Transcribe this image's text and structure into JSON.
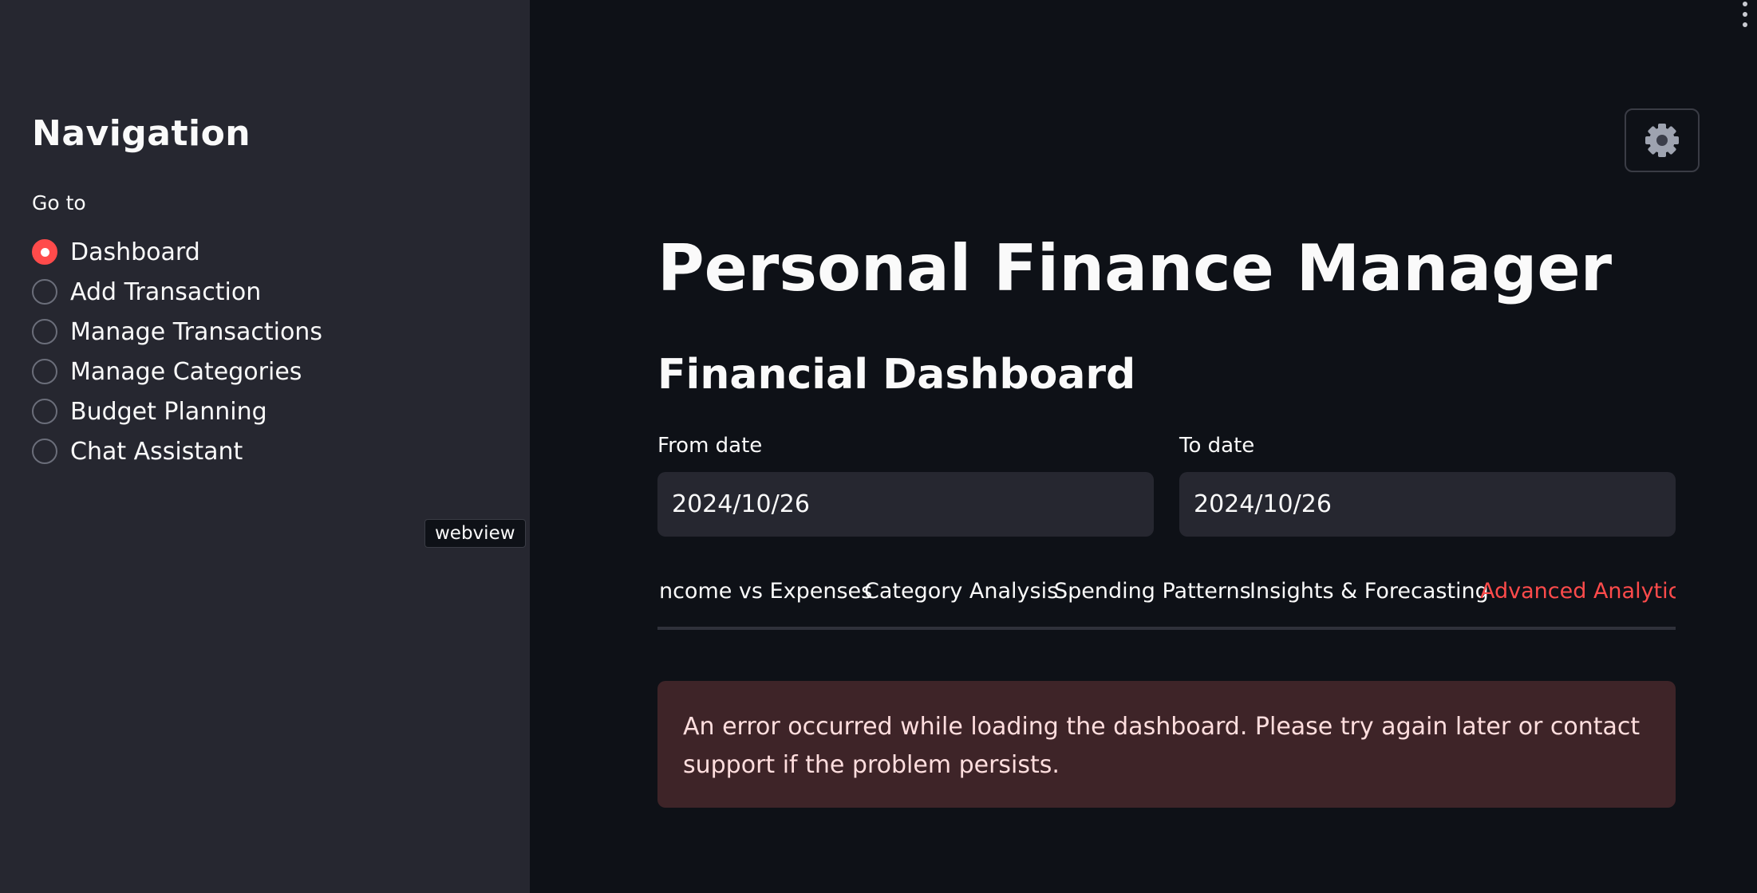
{
  "sidebar": {
    "title": "Navigation",
    "goto_label": "Go to",
    "items": [
      {
        "label": "Dashboard",
        "selected": true
      },
      {
        "label": "Add Transaction",
        "selected": false
      },
      {
        "label": "Manage Transactions",
        "selected": false
      },
      {
        "label": "Manage Categories",
        "selected": false
      },
      {
        "label": "Budget Planning",
        "selected": false
      },
      {
        "label": "Chat Assistant",
        "selected": false
      }
    ],
    "tooltip": "webview"
  },
  "header": {
    "settings_icon": "gear-icon",
    "menu_icon": "vertical-dots-icon"
  },
  "main": {
    "title": "Personal Finance Manager",
    "subtitle": "Financial Dashboard",
    "from_date": {
      "label": "From date",
      "value": "2024/10/26"
    },
    "to_date": {
      "label": "To date",
      "value": "2024/10/26"
    },
    "tabs": [
      {
        "label": "Income vs Expenses",
        "active": false
      },
      {
        "label": "Category Analysis",
        "active": false
      },
      {
        "label": "Spending Patterns",
        "active": false
      },
      {
        "label": "Insights & Forecasting",
        "active": false
      },
      {
        "label": "Advanced Analytics",
        "active": true
      }
    ],
    "error_message": "An error occurred while loading the dashboard. Please try again later or contact support if the problem persists."
  },
  "colors": {
    "accent": "#ff4b4b",
    "sidebar_bg": "#262730",
    "main_bg": "#0e1117",
    "error_bg": "#3e2428"
  }
}
